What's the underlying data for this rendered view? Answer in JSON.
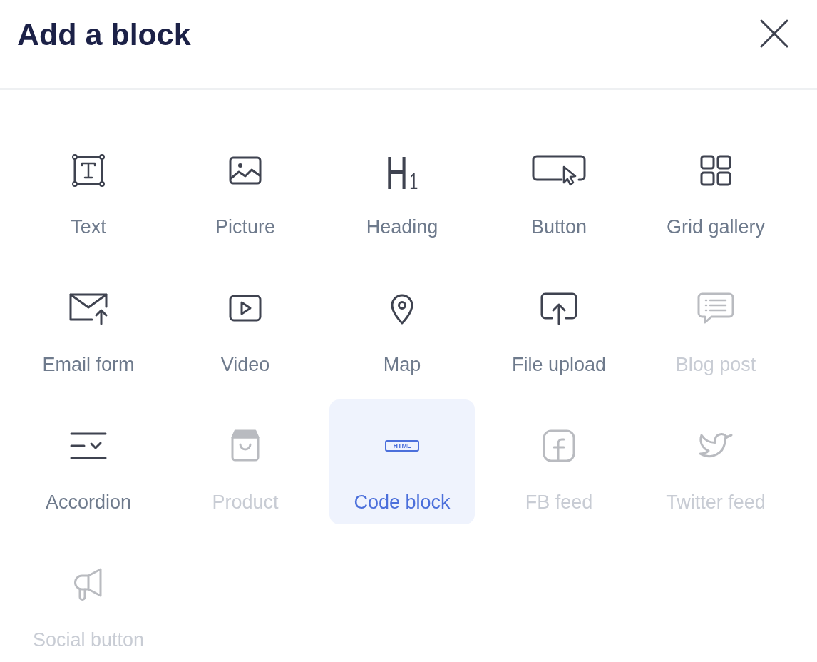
{
  "dialog": {
    "title": "Add a block"
  },
  "blocks": [
    {
      "kind": "text",
      "label": "Text",
      "selected": false,
      "disabled": false
    },
    {
      "kind": "picture",
      "label": "Picture",
      "selected": false,
      "disabled": false
    },
    {
      "kind": "heading",
      "icon_text": "H$_{1}$",
      "label": "Heading",
      "selected": false,
      "disabled": false
    },
    {
      "kind": "button",
      "label": "Button",
      "selected": false,
      "disabled": false
    },
    {
      "kind": "grid",
      "label": "Grid gallery",
      "selected": false,
      "disabled": false
    },
    {
      "kind": "email",
      "label": "Email form",
      "selected": false,
      "disabled": false
    },
    {
      "kind": "video",
      "label": "Video",
      "selected": false,
      "disabled": false
    },
    {
      "kind": "map",
      "label": "Map",
      "selected": false,
      "disabled": false
    },
    {
      "kind": "upload",
      "label": "File upload",
      "selected": false,
      "disabled": false
    },
    {
      "kind": "blog",
      "label": "Blog post",
      "selected": false,
      "disabled": true
    },
    {
      "kind": "accordion",
      "label": "Accordion",
      "selected": false,
      "disabled": false
    },
    {
      "kind": "product",
      "label": "Product",
      "selected": false,
      "disabled": true
    },
    {
      "kind": "code",
      "icon_text": "HTML",
      "label": "Code block",
      "selected": true,
      "disabled": false
    },
    {
      "kind": "facebook",
      "label": "FB feed",
      "selected": false,
      "disabled": true
    },
    {
      "kind": "twitter",
      "label": "Twitter feed",
      "selected": false,
      "disabled": true
    },
    {
      "kind": "social",
      "label": "Social button",
      "selected": false,
      "disabled": true
    }
  ]
}
